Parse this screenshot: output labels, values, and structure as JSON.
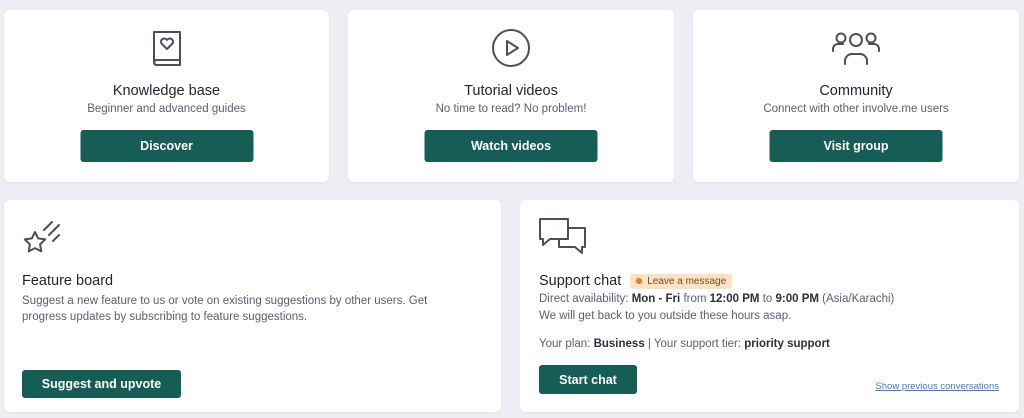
{
  "cards": {
    "knowledge": {
      "icon": "book-heart-icon",
      "title": "Knowledge base",
      "subtitle": "Beginner and advanced guides",
      "button": "Discover"
    },
    "tutorial": {
      "icon": "play-circle-icon",
      "title": "Tutorial videos",
      "subtitle": "No time to read? No problem!",
      "button": "Watch videos"
    },
    "community": {
      "icon": "users-group-icon",
      "title": "Community",
      "subtitle": "Connect with other involve.me users",
      "button": "Visit group"
    }
  },
  "feature_board": {
    "icon": "shooting-star-icon",
    "title": "Feature board",
    "description": "Suggest a new feature to us or vote on existing suggestions by other users. Get progress updates by subscribing to feature suggestions.",
    "button": "Suggest and upvote"
  },
  "support_chat": {
    "icon": "chat-bubbles-icon",
    "title": "Support chat",
    "badge": "Leave a message",
    "availability_label": "Direct availability:",
    "days": "Mon - Fri",
    "from_word": "from",
    "start_time": "12:00 PM",
    "to_word": "to",
    "end_time": "9:00 PM",
    "timezone": "(Asia/Karachi)",
    "outside_hours": "We will get back to you outside these hours asap.",
    "plan_label": "Your plan:",
    "plan": "Business",
    "separator": "|",
    "tier_label": "Your support tier:",
    "tier": "priority support",
    "button": "Start chat",
    "link": "Show previous conversations"
  },
  "colors": {
    "button_bg": "#155d55",
    "page_bg": "#eceef4",
    "badge_bg": "#fde2c4",
    "badge_dot": "#e97a1f",
    "link": "#3b7bd8"
  }
}
